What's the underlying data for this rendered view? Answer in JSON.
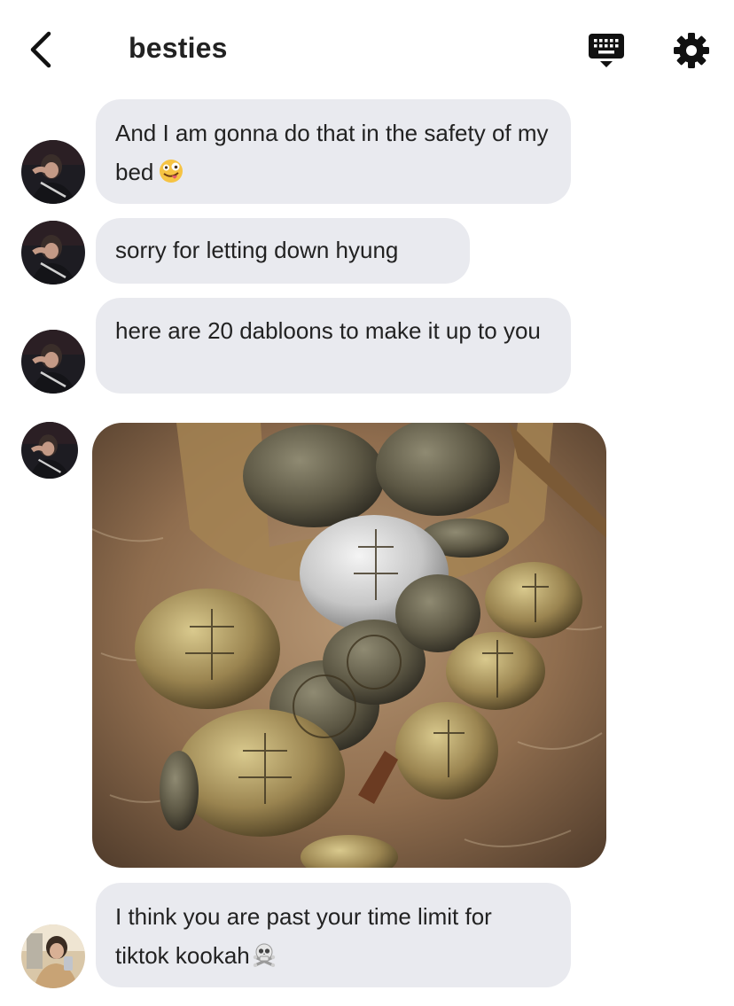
{
  "header": {
    "title": "besties",
    "back_icon": "chevron-left-icon",
    "keyboard_icon": "keyboard-icon",
    "settings_icon": "gear-icon"
  },
  "messages": [
    {
      "text": "And I am gonna do that in the safety of my bed",
      "emoji": "zany-face-emoji"
    },
    {
      "text": "sorry for letting down hyung"
    },
    {
      "text": "here are 20 dabloons to make it up to you"
    },
    {
      "type": "image",
      "image": "gold-coins-photo"
    },
    {
      "text": "I think you are past your time limit for tiktok kookah",
      "emoji": "skull-crossbones-emoji"
    }
  ],
  "colors": {
    "bubble": "#e9eaef",
    "text": "#222222",
    "background": "#ffffff"
  }
}
